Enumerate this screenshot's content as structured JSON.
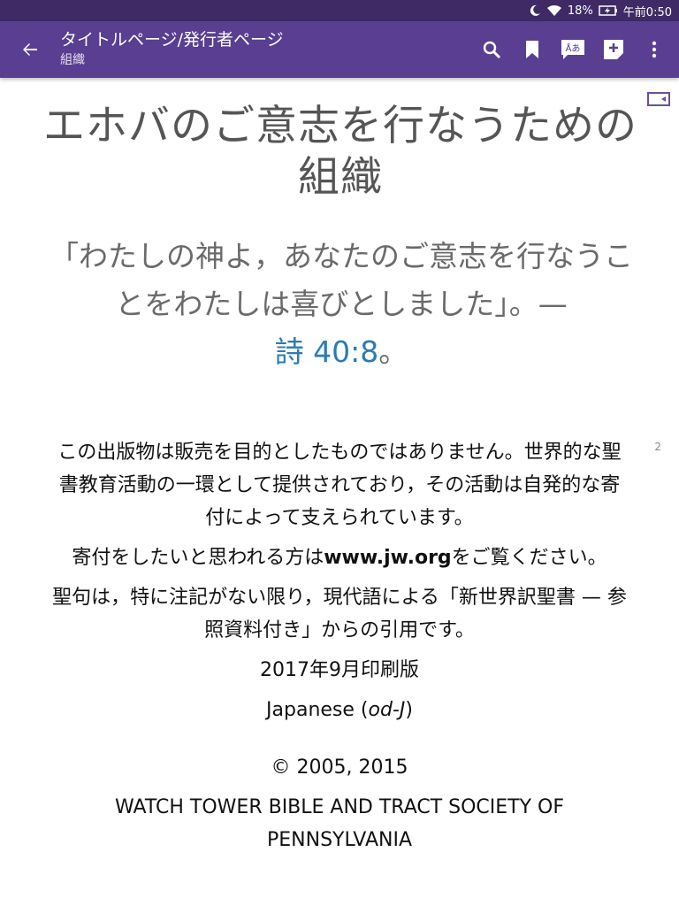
{
  "statusbar": {
    "battery": "18%",
    "time": "午前0:50",
    "icons": [
      "moon-icon",
      "wifi-icon",
      "battery-charging-icon"
    ]
  },
  "appbar": {
    "title": "タイトルページ/発行者ページ",
    "subtitle": "組織",
    "actions": [
      "search-icon",
      "bookmark-icon",
      "language-icon",
      "add-note-icon",
      "more-vert-icon"
    ],
    "language_label": "Åあ",
    "colors": {
      "background": "#5a3e91",
      "statusbar": "#3f2a66"
    }
  },
  "content": {
    "title": "エホバのご意志を行なうための組織",
    "quote_text": "「わたしの神よ，あなたのご意志を行なうことをわたしは喜びとしました」。—",
    "quote_ref": "詩 40:8",
    "quote_end": "。",
    "para_number": "2",
    "p1": "この出版物は販売を目的としたものではありません。世界的な聖書教育活動の一環として提供されており，その活動は自発的な寄付によって支えられています。",
    "p2_before": "寄付をしたいと思われる方は",
    "p2_link": "www.jw.org",
    "p2_after": "をご覧ください。",
    "p3": "聖句は，特に注記がない限り，現代語による「新世界訳聖書 — 参照資料付き」からの引用です。",
    "print_date": "2017年9月印刷版",
    "language_prefix": "Japanese (",
    "language_code": "od-J",
    "language_suffix": ")",
    "copyright": "© 2005, 2015",
    "publisher": "WATCH TOWER BIBLE AND TRACT SOCIETY OF PENNSYLVANIA",
    "link_color": "#2c7bb5"
  }
}
